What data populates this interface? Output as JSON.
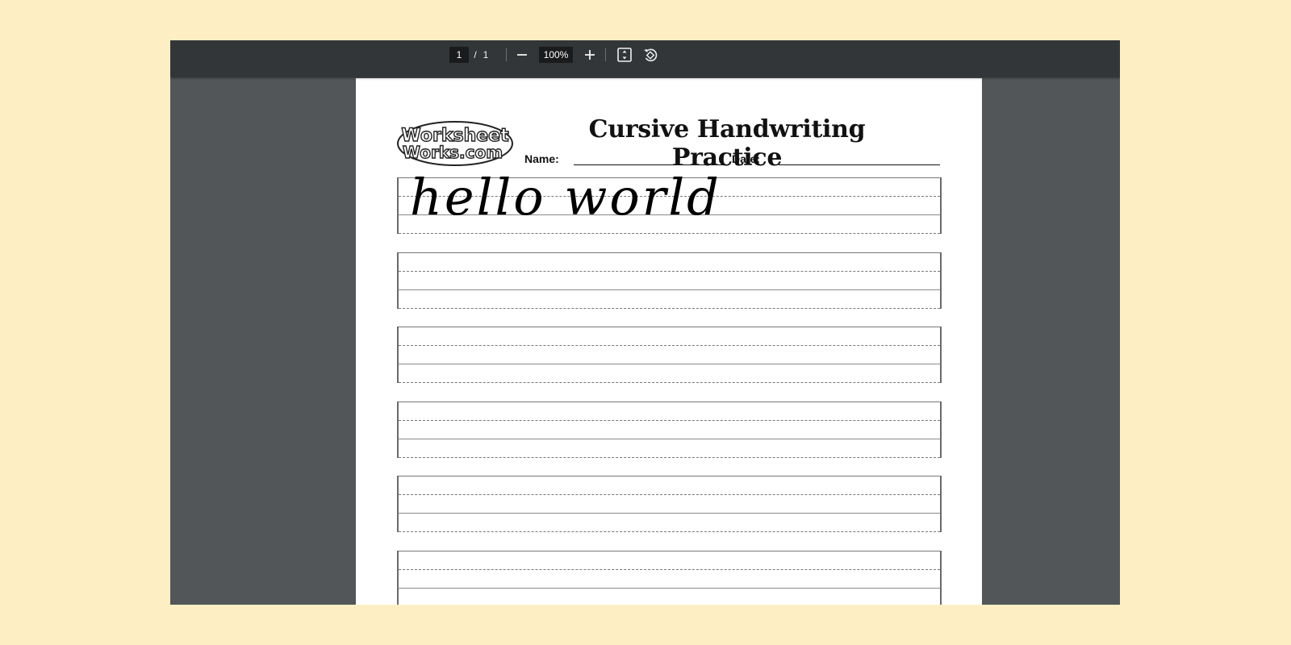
{
  "toolbar": {
    "page_current": "1",
    "page_separator": "/",
    "page_total": "1",
    "zoom_level": "100%",
    "icons": [
      "zoom-out-icon",
      "zoom-in-icon",
      "fit-to-page-icon",
      "rotate-icon"
    ]
  },
  "document": {
    "logo_text_line1": "Worksheet",
    "logo_text_line2": "Works.com",
    "title": "Cursive Handwriting Practice",
    "name_label": "Name:",
    "date_label": "Date:",
    "rows": [
      {
        "text": "hello world"
      },
      {
        "text": ""
      },
      {
        "text": ""
      },
      {
        "text": ""
      },
      {
        "text": ""
      },
      {
        "text": ""
      }
    ]
  },
  "colors": {
    "background": "#fdeec4",
    "viewer": "#525659",
    "toolbar": "#323639"
  }
}
